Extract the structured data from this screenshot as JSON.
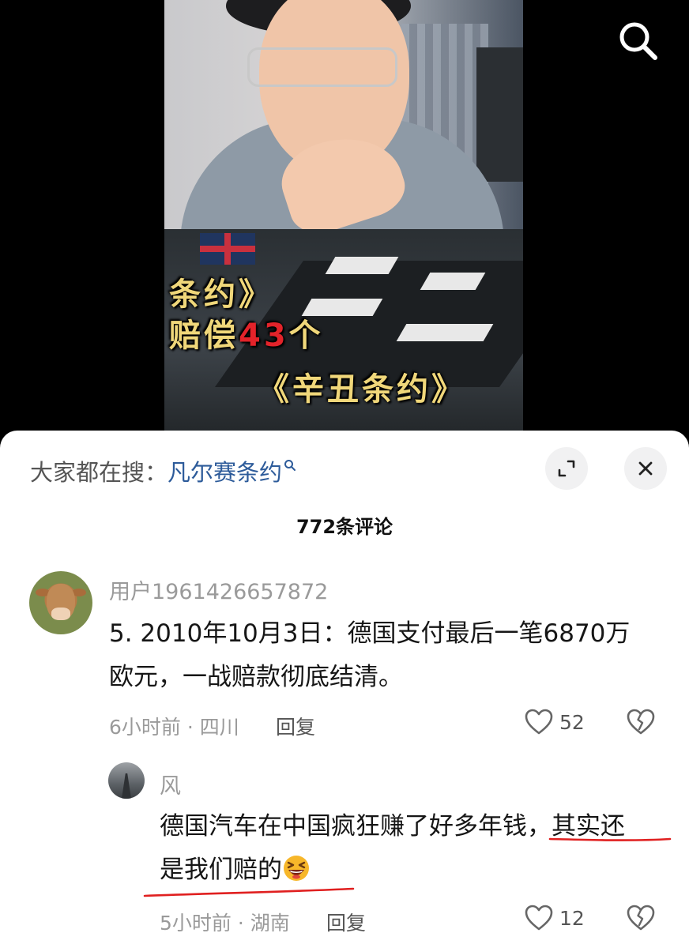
{
  "video": {
    "subtitle_line1": "条约》",
    "subtitle_line2_a": "赔偿",
    "subtitle_line2_num": "43",
    "subtitle_line2_b": "个",
    "subtitle_line3": "《辛丑条约》"
  },
  "icons": {
    "search": "search-icon",
    "expand": "expand-icon",
    "close": "close-icon",
    "heart": "heart-icon",
    "dislike": "broken-heart-icon",
    "emoji": "grinning-squint-emoji"
  },
  "sheet": {
    "suggest_label": "大家都在搜：",
    "suggest_term": "凡尔赛条约",
    "comment_count": "772条评论"
  },
  "comments": [
    {
      "username": "用户1961426657872",
      "text_line1": "5. 2010年10月3日：德国支付最后一笔6870万",
      "text_line2": "欧元，一战赔款彻底结清。",
      "meta": "6小时前 · 四川",
      "reply_label": "回复",
      "likes": "52"
    }
  ],
  "replies": [
    {
      "username": "风",
      "text_line1_a": "德国汽车在中国疯狂赚了好多年钱，",
      "text_line1_b": "其实还",
      "text_line2": "是我们赔的",
      "meta": "5小时前 · 湖南",
      "reply_label": "回复",
      "likes": "12"
    }
  ],
  "colors": {
    "link_blue": "#2d5b9a",
    "underline_red": "#e02020",
    "subtitle_yellow": "#f0d77a",
    "subtitle_red": "#e3232a"
  }
}
